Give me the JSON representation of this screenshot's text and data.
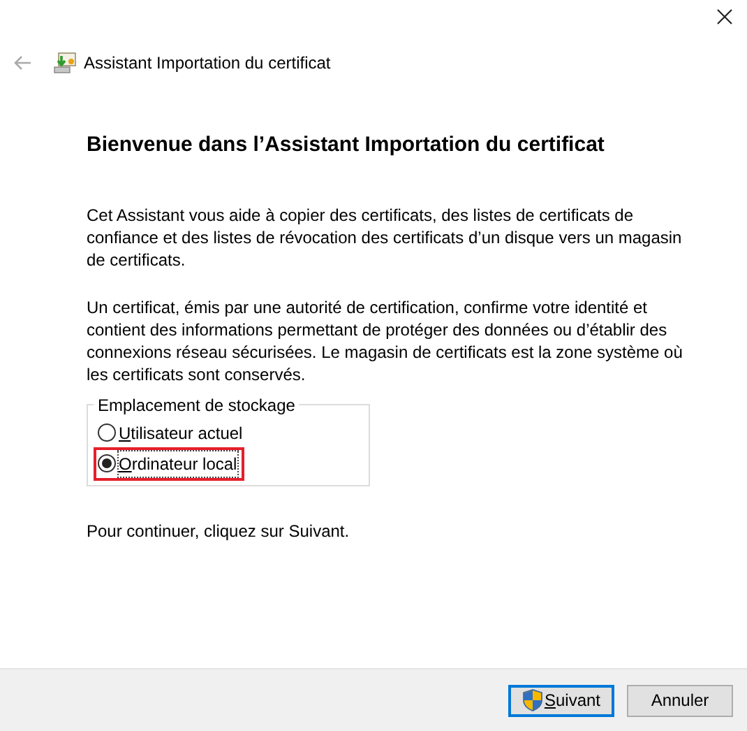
{
  "window": {
    "title": "Assistant Importation du certificat"
  },
  "heading": "Bienvenue dans l’Assistant Importation du certificat",
  "paragraphs": [
    "Cet Assistant vous aide à copier des certificats, des listes de certificats de confiance et des listes de révocation des certificats d’un disque vers un magasin de certificats.",
    "Un certificat, émis par une autorité de certification, confirme votre identité et contient des informations permettant de protéger des données ou d’établir des connexions réseau sécurisées. Le magasin de certificats est la zone système où les certificats sont conservés."
  ],
  "storage": {
    "label": "Emplacement de stockage",
    "options": [
      {
        "label": "Utilisateur actuel",
        "selected": false,
        "highlighted": false
      },
      {
        "label": "Ordinateur local",
        "selected": true,
        "highlighted": true
      }
    ]
  },
  "hint": "Pour continuer, cliquez sur Suivant.",
  "buttons": [
    {
      "label": "Suivant",
      "kind": "primary"
    },
    {
      "label": "Annuler",
      "kind": "secondary"
    }
  ]
}
